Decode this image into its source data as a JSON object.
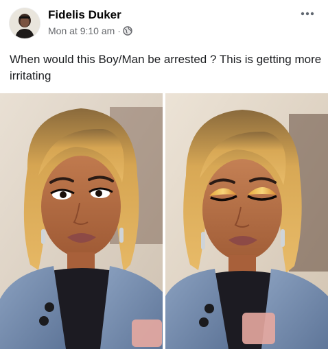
{
  "post": {
    "author": {
      "name": "Fidelis Duker"
    },
    "meta": {
      "timestamp": "Mon at 9:10 am",
      "separator": "·",
      "audience_icon": "globe-icon"
    },
    "menu_icon": "more-options-icon",
    "text": "When would this Boy/Man be arrested ? This is getting more irritating",
    "photos": [
      {
        "icon": "photo-1",
        "eyeshadow": "dark"
      },
      {
        "icon": "photo-2",
        "eyeshadow": "gold"
      }
    ]
  },
  "colors": {
    "name": "#050505",
    "meta": "#65676b",
    "text": "#1c1e21",
    "hair": "#d6a552",
    "skin": "#b86d45",
    "jacket": "#7d93b3"
  }
}
